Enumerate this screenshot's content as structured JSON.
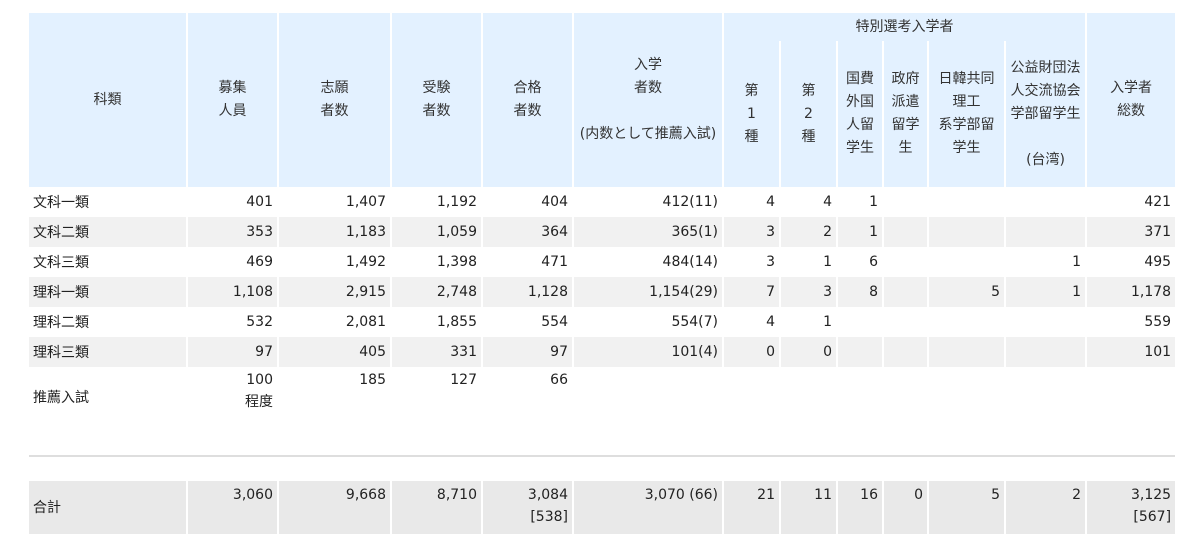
{
  "header": {
    "kamoku": "科類",
    "boshu": "募集\n人員",
    "shigan": "志願\n者数",
    "juken": "受験\n者数",
    "gokaku": "合格\n者数",
    "nyugaku": "入学\n者数\n\n(内数として推薦入試)",
    "tokubetsu_group": "特別選考入学者",
    "dai1": "第\n1\n種",
    "dai2": "第\n2\n種",
    "kokuhi": "国費\n外国\n人留\n学生",
    "seifu": "政府\n派遣\n留学\n生",
    "nikkan": "日韓共同\n理工\n系学部留\n学生",
    "koeki": "公益財団法\n人交流協会\n学部留学生\n\n(台湾)",
    "sosu": "入学者\n総数"
  },
  "rows": [
    {
      "name": "文科一類",
      "boshu": "401",
      "shigan": "1,407",
      "juken": "1,192",
      "gokaku": "404",
      "nyugaku": "412(11)",
      "dai1": "4",
      "dai2": "4",
      "kokuhi": "1",
      "seifu": "",
      "nikkan": "",
      "koeki": "",
      "sosu": "421"
    },
    {
      "name": "文科二類",
      "boshu": "353",
      "shigan": "1,183",
      "juken": "1,059",
      "gokaku": "364",
      "nyugaku": "365(1)",
      "dai1": "3",
      "dai2": "2",
      "kokuhi": "1",
      "seifu": "",
      "nikkan": "",
      "koeki": "",
      "sosu": "371"
    },
    {
      "name": "文科三類",
      "boshu": "469",
      "shigan": "1,492",
      "juken": "1,398",
      "gokaku": "471",
      "nyugaku": "484(14)",
      "dai1": "3",
      "dai2": "1",
      "kokuhi": "6",
      "seifu": "",
      "nikkan": "",
      "koeki": "1",
      "sosu": "495"
    },
    {
      "name": "理科一類",
      "boshu": "1,108",
      "shigan": "2,915",
      "juken": "2,748",
      "gokaku": "1,128",
      "nyugaku": "1,154(29)",
      "dai1": "7",
      "dai2": "3",
      "kokuhi": "8",
      "seifu": "",
      "nikkan": "5",
      "koeki": "1",
      "sosu": "1,178"
    },
    {
      "name": "理科二類",
      "boshu": "532",
      "shigan": "2,081",
      "juken": "1,855",
      "gokaku": "554",
      "nyugaku": "554(7)",
      "dai1": "4",
      "dai2": "1",
      "kokuhi": "",
      "seifu": "",
      "nikkan": "",
      "koeki": "",
      "sosu": "559"
    },
    {
      "name": "理科三類",
      "boshu": "97",
      "shigan": "405",
      "juken": "331",
      "gokaku": "97",
      "nyugaku": "101(4)",
      "dai1": "0",
      "dai2": "0",
      "kokuhi": "",
      "seifu": "",
      "nikkan": "",
      "koeki": "",
      "sosu": "101"
    }
  ],
  "recommend": {
    "name": "推薦入試",
    "boshu": "100\n程度",
    "shigan": "185",
    "juken": "127",
    "gokaku": "66"
  },
  "total": {
    "name": "合計",
    "boshu": "3,060",
    "shigan": "9,668",
    "juken": "8,710",
    "gokaku": "3,084\n[538]",
    "nyugaku": "3,070 (66)",
    "dai1": "21",
    "dai2": "11",
    "kokuhi": "16",
    "seifu": "0",
    "nikkan": "5",
    "koeki": "2",
    "sosu": "3,125\n[567]"
  }
}
